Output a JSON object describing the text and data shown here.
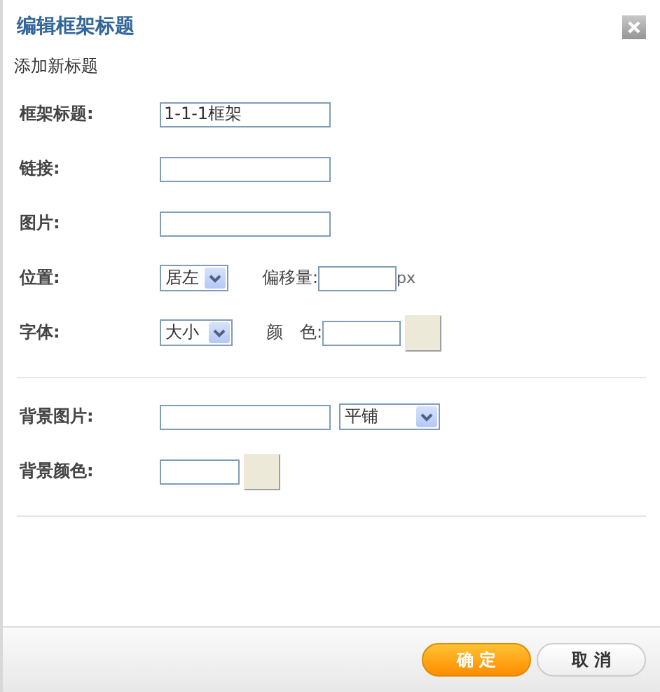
{
  "dialog": {
    "title": "编辑框架标题",
    "subtitle": "添加新标题"
  },
  "section_1": [
    {
      "label": "框架标题:",
      "kind": "text",
      "value": "1-1-1框架"
    },
    {
      "label": "链接:",
      "kind": "text"
    },
    {
      "label": "图片:",
      "kind": "text"
    },
    {
      "label": "位置:",
      "kind": "select-offset",
      "select": "居左",
      "extra_label": "偏移量:",
      "unit": "px"
    },
    {
      "label": "字体:",
      "kind": "select-color",
      "select": "大小",
      "extra_label": "颜　色:"
    }
  ],
  "section_2": [
    {
      "label": "背景图片:",
      "kind": "text-select",
      "select": "平铺"
    },
    {
      "label": "背景颜色:",
      "kind": "color"
    }
  ],
  "buttons": [
    {
      "label": "确 定",
      "kind": "primary"
    },
    {
      "label": "取 消",
      "kind": "secondary"
    }
  ]
}
